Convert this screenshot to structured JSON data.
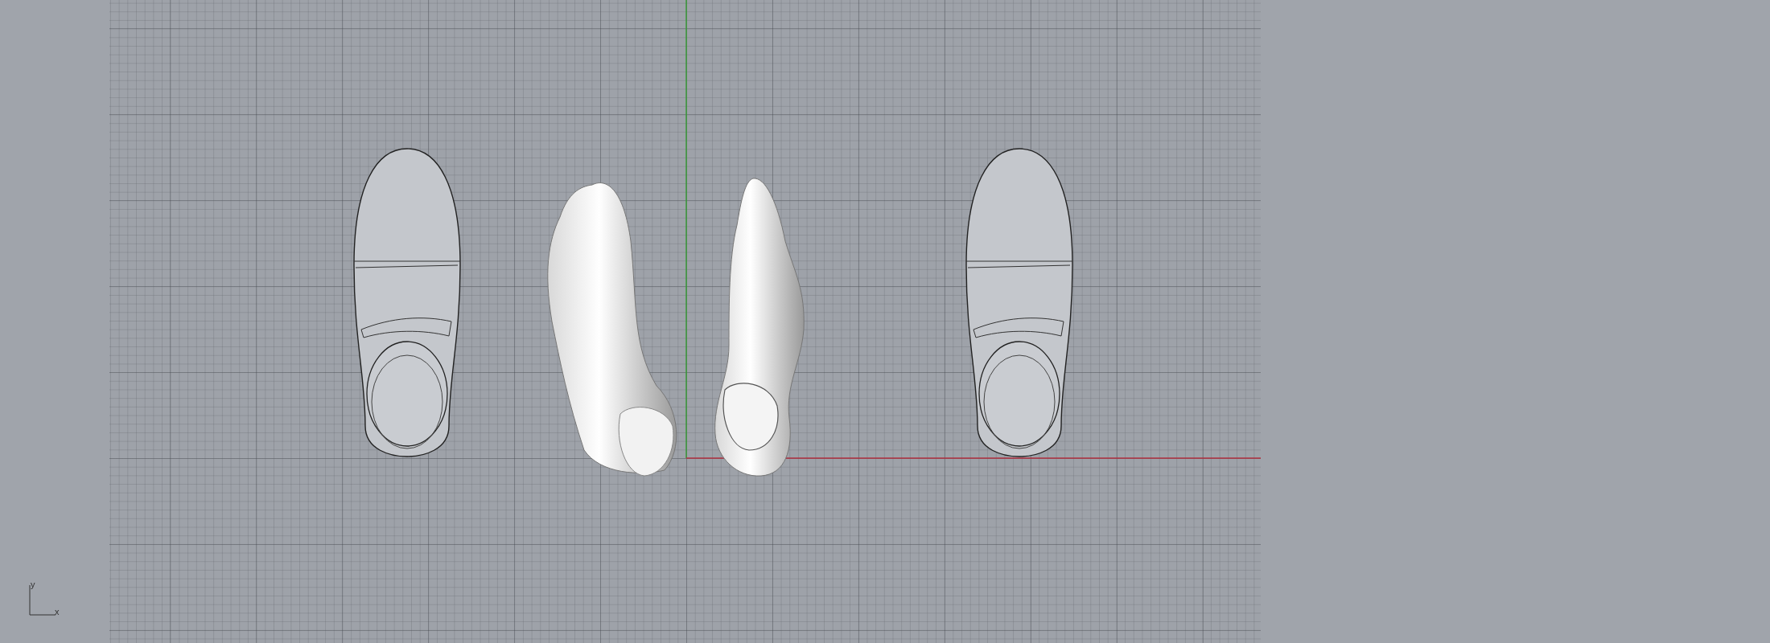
{
  "axis_widget": {
    "y_label": "y",
    "x_label": "x"
  }
}
